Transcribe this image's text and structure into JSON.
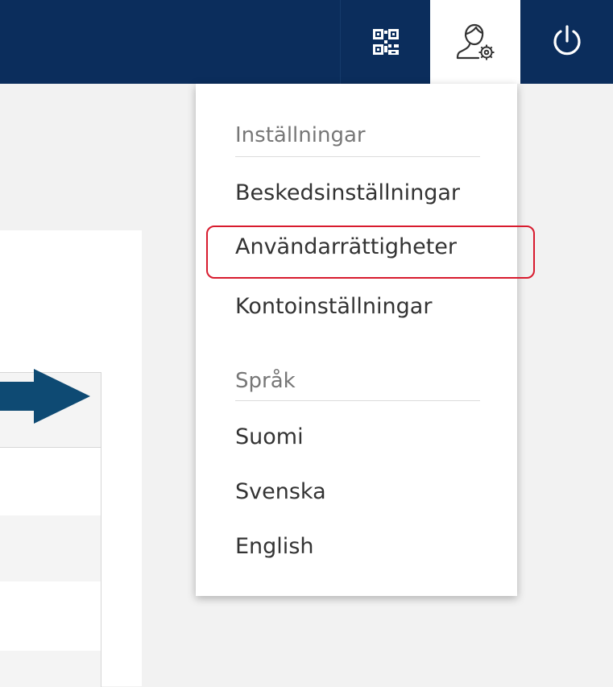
{
  "header": {
    "qr_icon": "qr-code-icon",
    "user_icon": "user-settings-icon",
    "power_icon": "power-icon",
    "background_color": "#0b2d5c"
  },
  "dropdown": {
    "settings_label": "Inställningar",
    "settings_items": [
      {
        "label": "Beskedsinställningar"
      },
      {
        "label": "Användarrättigheter",
        "highlighted": true
      },
      {
        "label": "Kontoinställningar"
      }
    ],
    "language_label": "Språk",
    "language_items": [
      {
        "label": "Suomi"
      },
      {
        "label": "Svenska"
      },
      {
        "label": "English"
      }
    ]
  },
  "annotation": {
    "arrow_color": "#0e4a73",
    "highlight_color": "#d81b2e"
  }
}
